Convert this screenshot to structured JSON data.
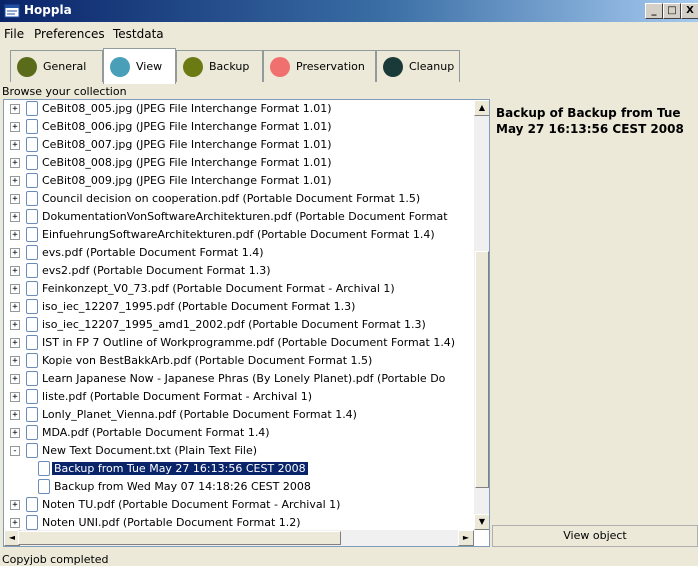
{
  "window": {
    "title": "Hoppla",
    "minimize": "_",
    "maximize": "□",
    "close": "X"
  },
  "menu": [
    "File",
    "Preferences",
    "Testdata"
  ],
  "tabs": [
    {
      "label": "General",
      "color": "#5a6b1a",
      "active": false
    },
    {
      "label": "View",
      "color": "#4a9fb8",
      "active": true
    },
    {
      "label": "Backup",
      "color": "#6b7a12",
      "active": false
    },
    {
      "label": "Preservation",
      "color": "#f07070",
      "active": false
    },
    {
      "label": "Cleanup",
      "color": "#1a3a3a",
      "active": false
    }
  ],
  "browse_label": "Browse your collection",
  "tree": [
    {
      "label": "CeBit08_005.jpg (JPEG File Interchange Format 1.01)",
      "level": 0,
      "state": "+"
    },
    {
      "label": "CeBit08_006.jpg (JPEG File Interchange Format 1.01)",
      "level": 0,
      "state": "+"
    },
    {
      "label": "CeBit08_007.jpg (JPEG File Interchange Format 1.01)",
      "level": 0,
      "state": "+"
    },
    {
      "label": "CeBit08_008.jpg (JPEG File Interchange Format 1.01)",
      "level": 0,
      "state": "+"
    },
    {
      "label": "CeBit08_009.jpg (JPEG File Interchange Format 1.01)",
      "level": 0,
      "state": "+"
    },
    {
      "label": "Council decision on cooperation.pdf (Portable Document Format 1.5)",
      "level": 0,
      "state": "+"
    },
    {
      "label": "DokumentationVonSoftwareArchitekturen.pdf (Portable Document Format",
      "level": 0,
      "state": "+"
    },
    {
      "label": "EinfuehrungSoftwareArchitekturen.pdf (Portable Document Format 1.4)",
      "level": 0,
      "state": "+"
    },
    {
      "label": "evs.pdf (Portable Document Format 1.4)",
      "level": 0,
      "state": "+"
    },
    {
      "label": "evs2.pdf (Portable Document Format 1.3)",
      "level": 0,
      "state": "+"
    },
    {
      "label": "Feinkonzept_V0_73.pdf (Portable Document Format - Archival 1)",
      "level": 0,
      "state": "+"
    },
    {
      "label": "iso_iec_12207_1995.pdf (Portable Document Format 1.3)",
      "level": 0,
      "state": "+"
    },
    {
      "label": "iso_iec_12207_1995_amd1_2002.pdf (Portable Document Format 1.3)",
      "level": 0,
      "state": "+"
    },
    {
      "label": "IST in FP 7 Outline of Workprogramme.pdf (Portable Document Format 1.4)",
      "level": 0,
      "state": "+"
    },
    {
      "label": "Kopie von BestBakkArb.pdf (Portable Document Format 1.5)",
      "level": 0,
      "state": "+"
    },
    {
      "label": "Learn Japanese Now - Japanese Phras (By Lonely Planet).pdf (Portable Do",
      "level": 0,
      "state": "+"
    },
    {
      "label": "liste.pdf (Portable Document Format - Archival 1)",
      "level": 0,
      "state": "+"
    },
    {
      "label": "Lonly_Planet_Vienna.pdf (Portable Document Format 1.4)",
      "level": 0,
      "state": "+"
    },
    {
      "label": "MDA.pdf (Portable Document Format 1.4)",
      "level": 0,
      "state": "+"
    },
    {
      "label": "New Text Document.txt (Plain Text File)",
      "level": 0,
      "state": "-"
    },
    {
      "label": "Backup from Tue May 27 16:13:56 CEST 2008",
      "level": 1,
      "state": "",
      "selected": true
    },
    {
      "label": "Backup from Wed May 07 14:18:26 CEST 2008",
      "level": 1,
      "state": ""
    },
    {
      "label": "Noten TU.pdf (Portable Document Format - Archival 1)",
      "level": 0,
      "state": "+"
    },
    {
      "label": "Noten UNI.pdf (Portable Document Format 1.2)",
      "level": 0,
      "state": "+"
    }
  ],
  "scrollbar": {
    "up": "▲",
    "down": "▼",
    "left": "◄",
    "right": "►",
    "vertical_position": 0.34,
    "vertical_visible": 0.59,
    "horizontal_position": 0.0,
    "horizontal_visible": 0.73
  },
  "detail": {
    "text": "Backup of Backup from Tue May 27 16:13:56 CEST 2008"
  },
  "view_object_label": "View object",
  "status": "Copyjob completed"
}
